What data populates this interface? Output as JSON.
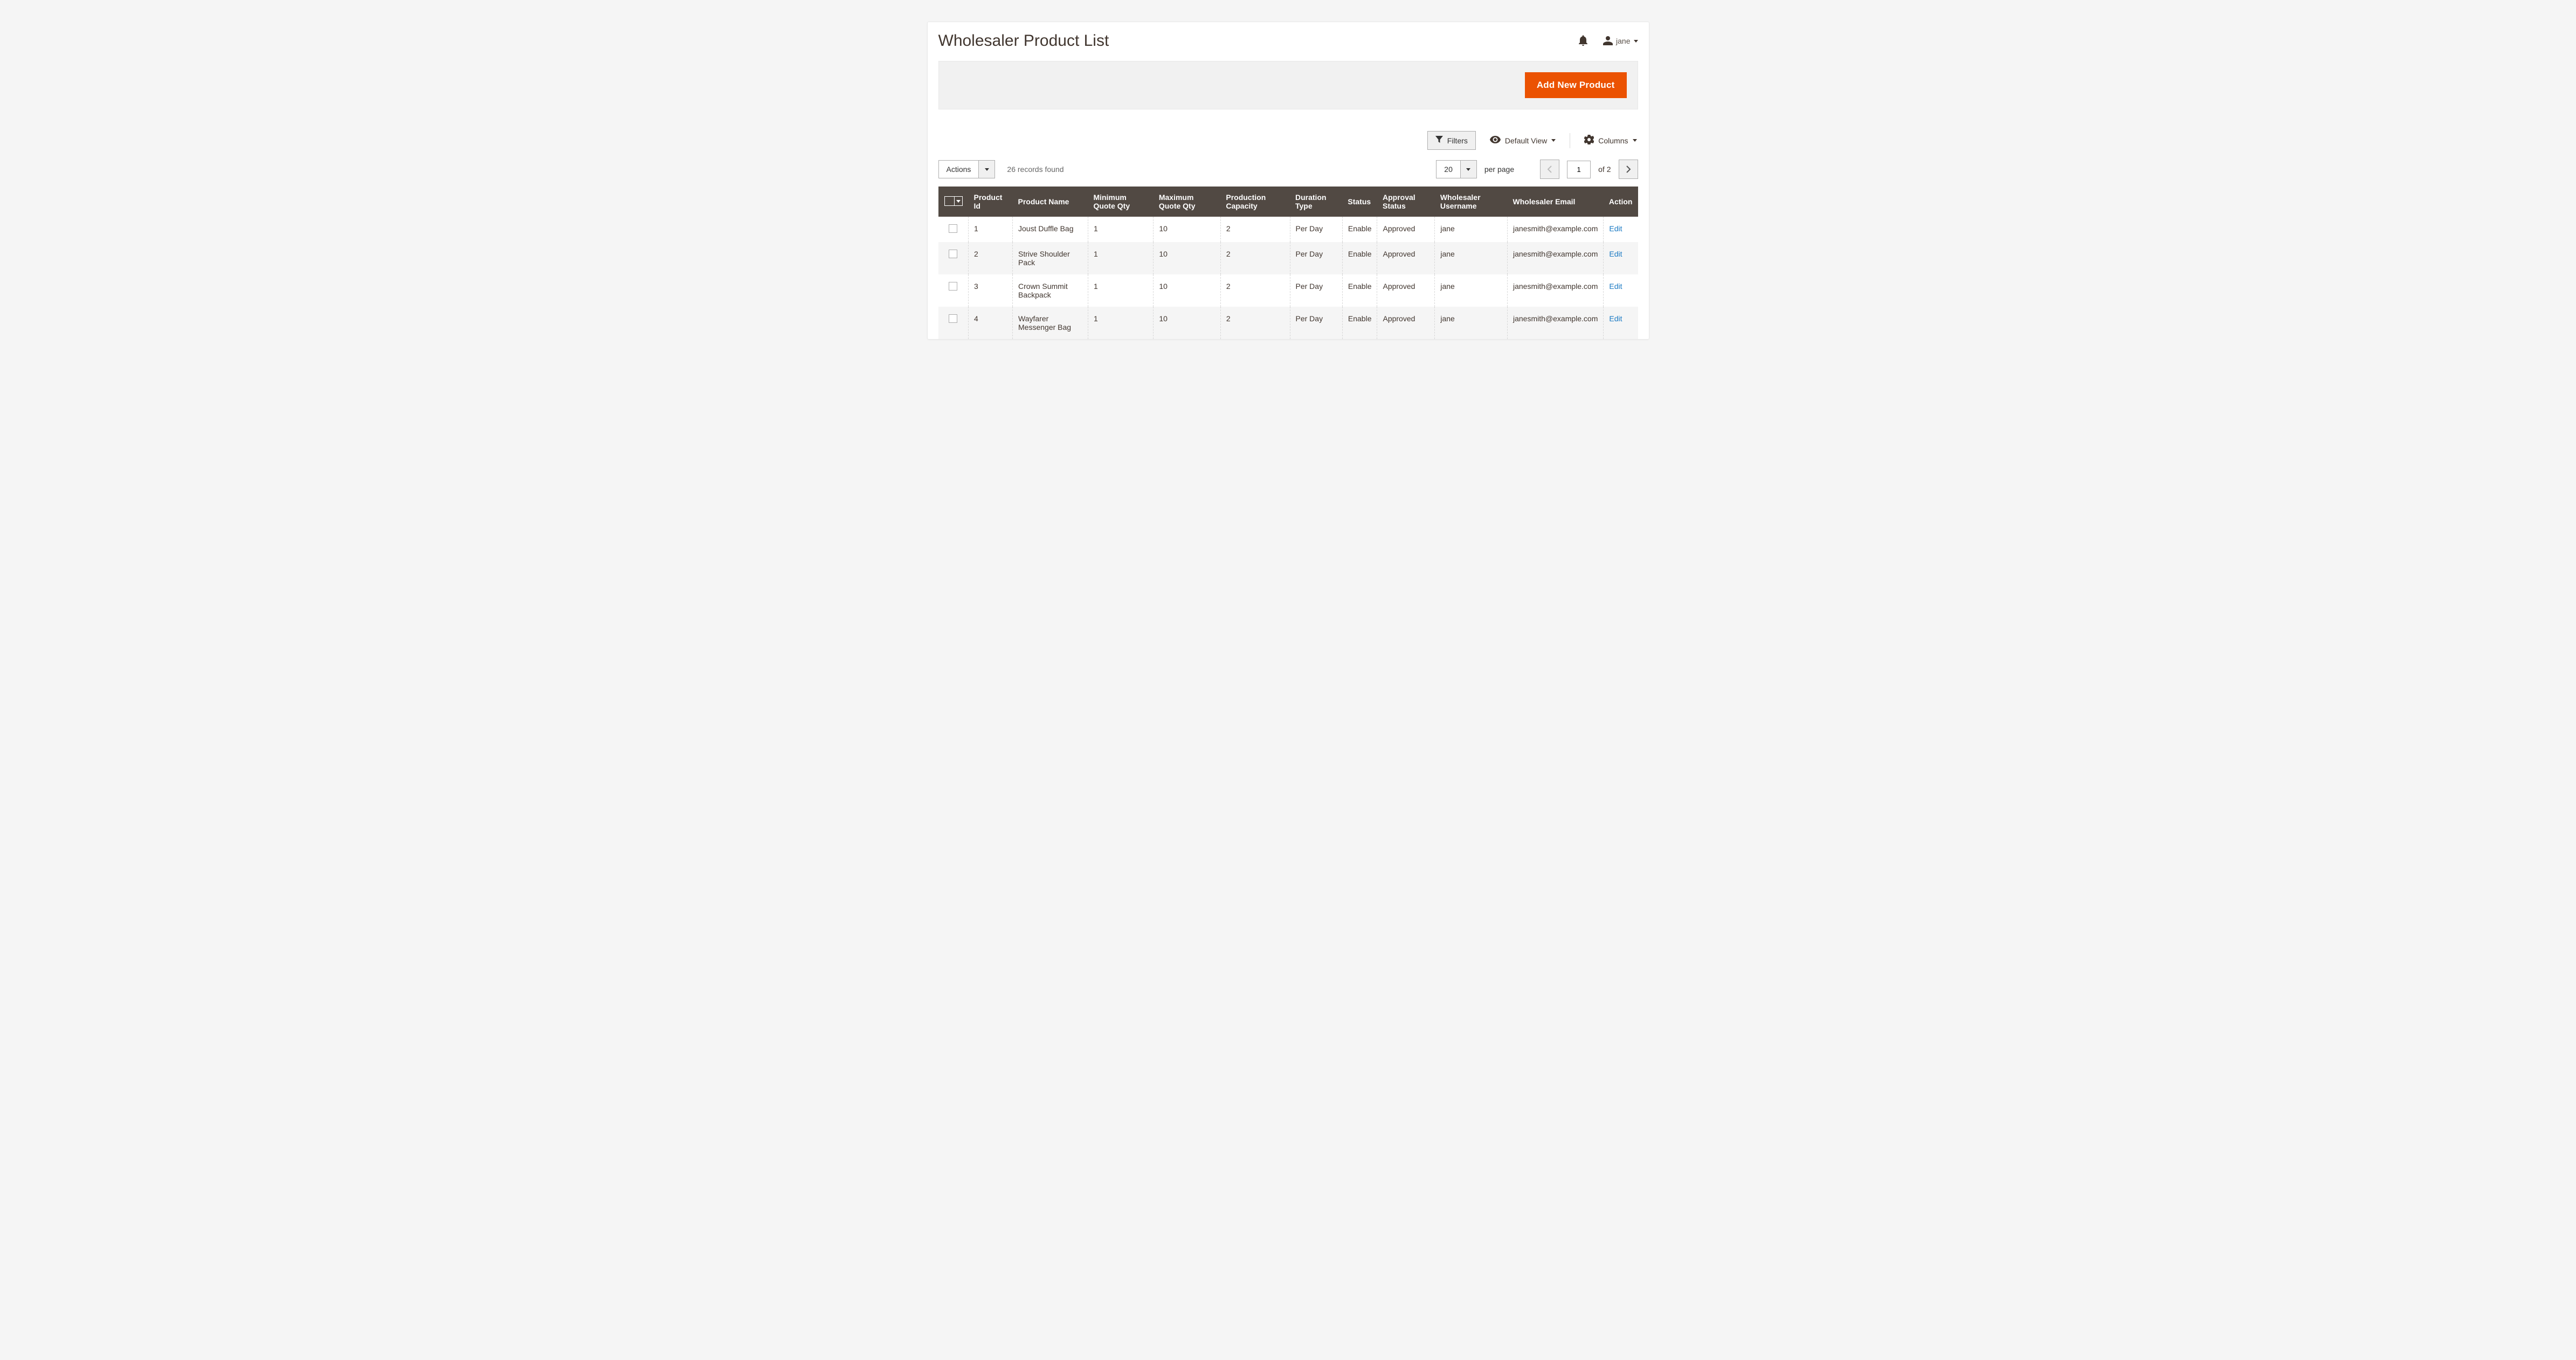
{
  "header": {
    "title": "Wholesaler Product List",
    "username": "jane"
  },
  "toolbar": {
    "add_new_label": "Add New Product"
  },
  "controls": {
    "filters_label": "Filters",
    "default_view_label": "Default View",
    "columns_label": "Columns"
  },
  "pager": {
    "actions_label": "Actions",
    "records_found": "26 records found",
    "page_size": "20",
    "per_page_label": "per page",
    "current_page": "1",
    "of_label": "of 2"
  },
  "table": {
    "headers": {
      "product_id": "Product Id",
      "product_name": "Product Name",
      "min_qty": "Minimum Quote Qty",
      "max_qty": "Maximum Quote Qty",
      "prod_cap": "Production Capacity",
      "duration": "Duration Type",
      "status": "Status",
      "approval": "Approval Status",
      "ws_user": "Wholesaler Username",
      "ws_email": "Wholesaler Email",
      "action": "Action"
    },
    "rows": [
      {
        "id": "1",
        "name": "Joust Duffle Bag",
        "min": "1",
        "max": "10",
        "cap": "2",
        "dur": "Per Day",
        "status": "Enable",
        "appr": "Approved",
        "user": "jane",
        "email": "janesmith@example.com",
        "action": "Edit"
      },
      {
        "id": "2",
        "name": "Strive Shoulder Pack",
        "min": "1",
        "max": "10",
        "cap": "2",
        "dur": "Per Day",
        "status": "Enable",
        "appr": "Approved",
        "user": "jane",
        "email": "janesmith@example.com",
        "action": "Edit"
      },
      {
        "id": "3",
        "name": "Crown Summit Backpack",
        "min": "1",
        "max": "10",
        "cap": "2",
        "dur": "Per Day",
        "status": "Enable",
        "appr": "Approved",
        "user": "jane",
        "email": "janesmith@example.com",
        "action": "Edit"
      },
      {
        "id": "4",
        "name": "Wayfarer Messenger Bag",
        "min": "1",
        "max": "10",
        "cap": "2",
        "dur": "Per Day",
        "status": "Enable",
        "appr": "Approved",
        "user": "jane",
        "email": "janesmith@example.com",
        "action": "Edit"
      }
    ]
  }
}
